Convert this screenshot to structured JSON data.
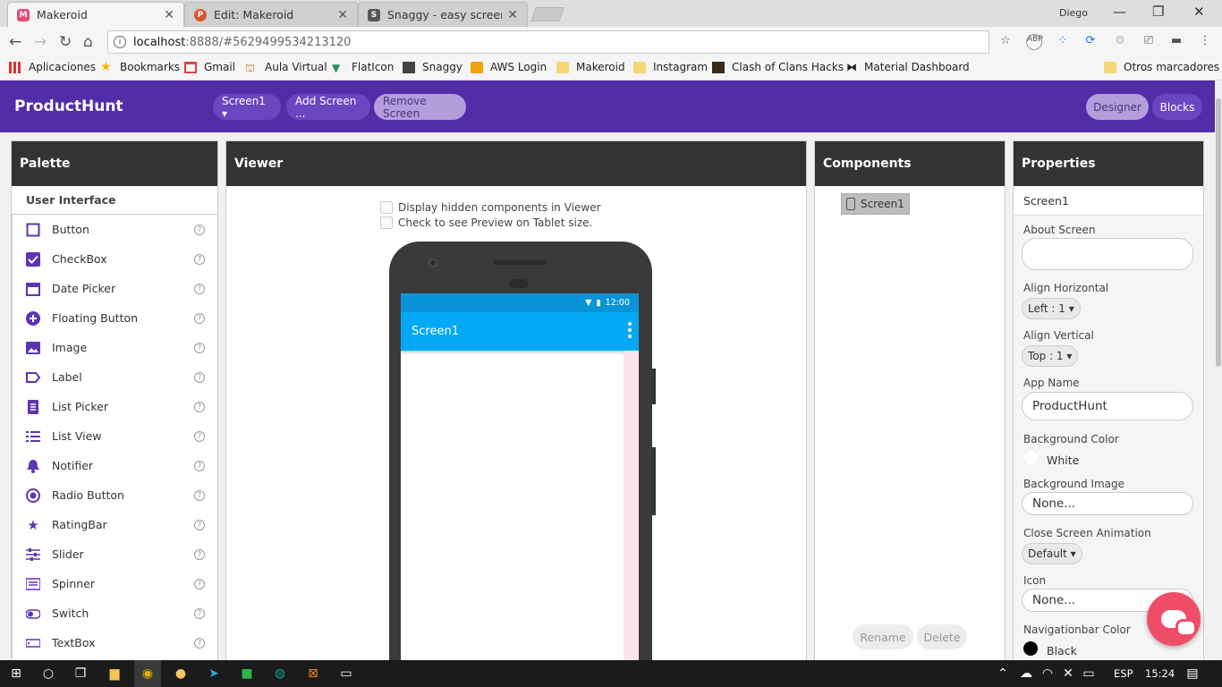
{
  "browser": {
    "tabs": [
      {
        "title": "Makeroid",
        "active": true,
        "icon": "makeroid-favicon"
      },
      {
        "title": "Edit: Makeroid",
        "active": false,
        "icon": "producthunt-favicon"
      },
      {
        "title": "Snaggy - easy screensho",
        "active": false,
        "icon": "snaggy-favicon"
      }
    ],
    "user": "Diego",
    "url_host": "localhost",
    "url_path": ":8888/#5629499534213120",
    "bookmarks": [
      "Aplicaciones",
      "Bookmarks",
      "Gmail",
      "Aula Virtual",
      "FlatIcon",
      "Snaggy",
      "AWS Login",
      "Makeroid",
      "Instagram",
      "Clash of Clans Hacks",
      "Material Dashboard F",
      "Otros marcadores"
    ]
  },
  "appbar": {
    "brand": "ProductHunt",
    "screen_select": "Screen1 ▾",
    "add_screen": "Add Screen ...",
    "remove_screen": "Remove Screen",
    "designer": "Designer",
    "blocks": "Blocks",
    "color": "#512da8"
  },
  "palette": {
    "title": "Palette",
    "section": "User Interface",
    "help_glyph": "?",
    "items": [
      {
        "label": "Button",
        "icon": "button-icon"
      },
      {
        "label": "CheckBox",
        "icon": "checkbox-icon"
      },
      {
        "label": "Date Picker",
        "icon": "calendar-icon"
      },
      {
        "label": "Floating Button",
        "icon": "plus-circle-icon"
      },
      {
        "label": "Image",
        "icon": "image-icon"
      },
      {
        "label": "Label",
        "icon": "label-icon"
      },
      {
        "label": "List Picker",
        "icon": "list-picker-icon"
      },
      {
        "label": "List View",
        "icon": "list-view-icon"
      },
      {
        "label": "Notifier",
        "icon": "bell-icon"
      },
      {
        "label": "Radio Button",
        "icon": "radio-icon"
      },
      {
        "label": "RatingBar",
        "icon": "star-icon"
      },
      {
        "label": "Slider",
        "icon": "slider-icon"
      },
      {
        "label": "Spinner",
        "icon": "spinner-icon"
      },
      {
        "label": "Switch",
        "icon": "switch-icon"
      },
      {
        "label": "TextBox",
        "icon": "textbox-icon"
      }
    ]
  },
  "viewer": {
    "title": "Viewer",
    "check_hidden": "Display hidden components in Viewer",
    "check_tablet": "Check to see Preview on Tablet size.",
    "phone": {
      "time": "12:00",
      "screen_title": "Screen1"
    }
  },
  "components": {
    "title": "Components",
    "root": "Screen1",
    "rename": "Rename",
    "delete": "Delete"
  },
  "properties": {
    "title": "Properties",
    "target": "Screen1",
    "about_screen_label": "About Screen",
    "align_horizontal_label": "Align Horizontal",
    "align_horizontal_value": "Left : 1 ▾",
    "align_vertical_label": "Align Vertical",
    "align_vertical_value": "Top : 1 ▾",
    "app_name_label": "App Name",
    "app_name_value": "ProductHunt",
    "bg_color_label": "Background Color",
    "bg_color_value": "White",
    "bg_image_label": "Background Image",
    "bg_image_value": "None...",
    "close_anim_label": "Close Screen Animation",
    "close_anim_value": "Default ▾",
    "icon_label": "Icon",
    "icon_value": "None...",
    "navbar_color_label": "Navigationbar Color",
    "navbar_color_value": "Black"
  },
  "taskbar": {
    "lang": "ESP",
    "time": "15:24"
  }
}
